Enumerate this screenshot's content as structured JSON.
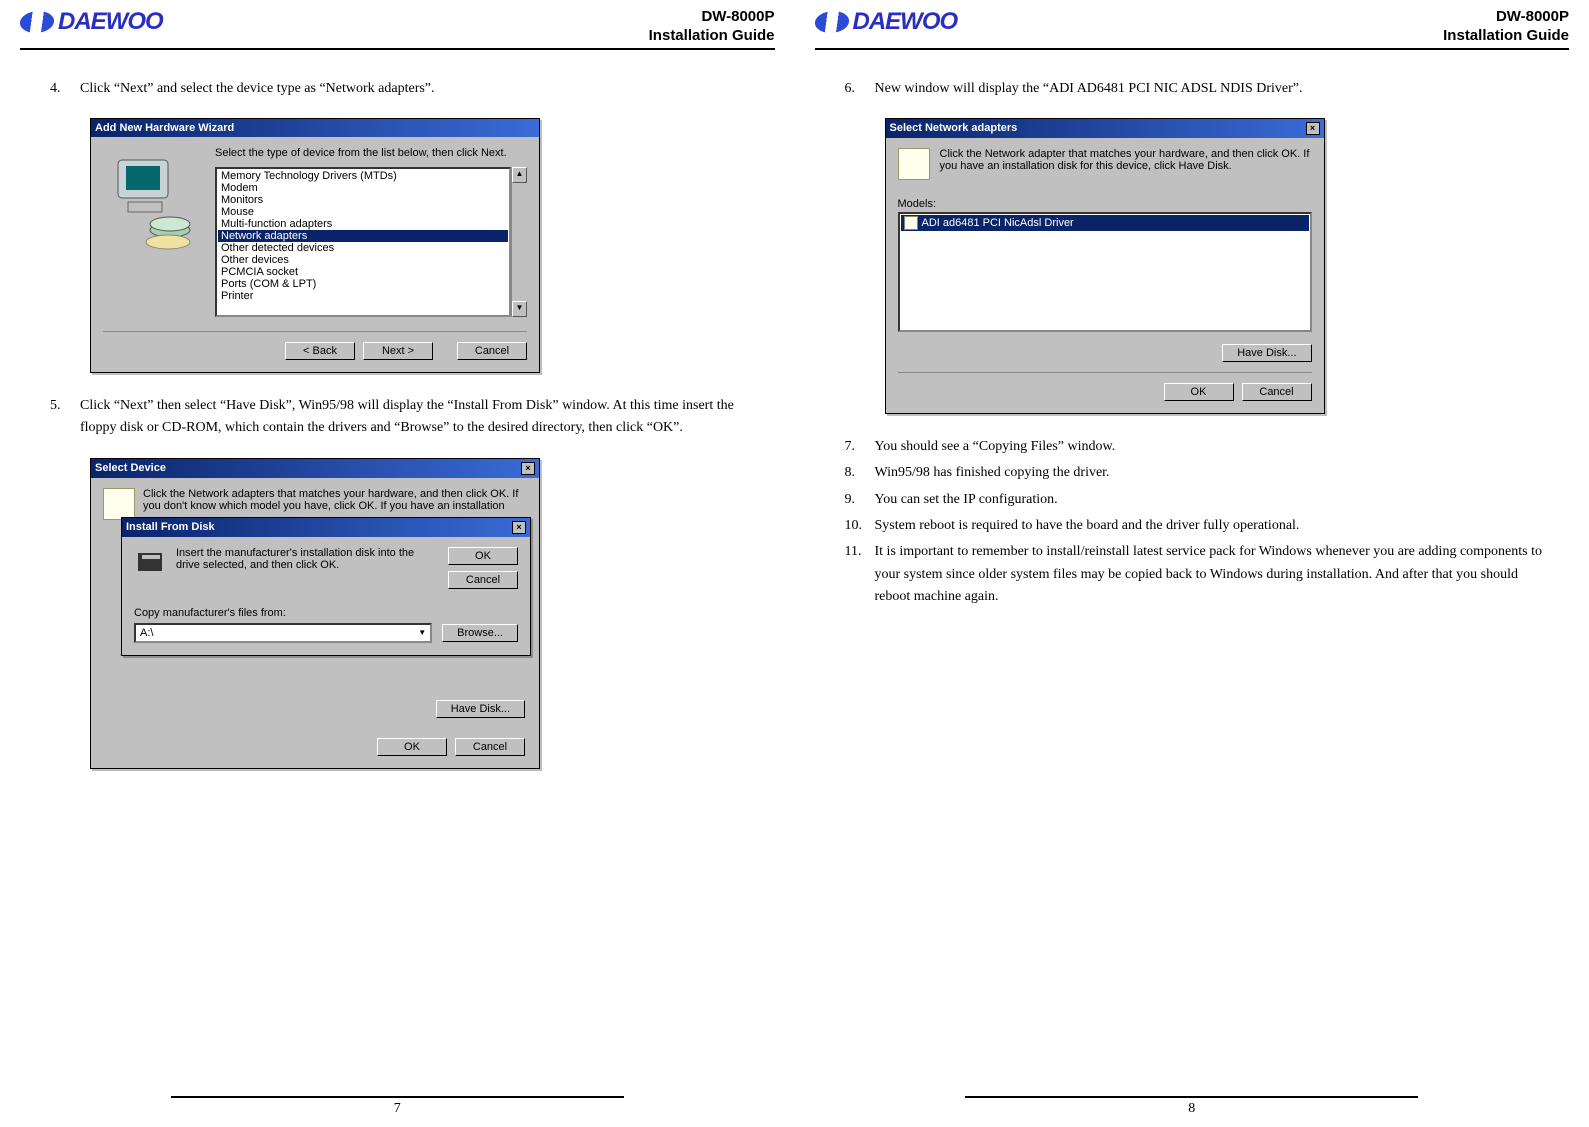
{
  "brand": "DAEWOO",
  "doc_title_line1": "DW-8000P",
  "doc_title_line2": "Installation Guide",
  "left_page": {
    "number": "7",
    "steps": [
      {
        "n": "4.",
        "text": "Click “Next” and select the device type as “Network adapters”."
      },
      {
        "n": "5.",
        "text": "Click “Next” then select “Have Disk”, Win95/98 will display the “Install From Disk” window. At this time insert the floppy disk or CD-ROM, which contain the drivers and “Browse” to the desired directory, then click “OK”."
      }
    ],
    "dlg1": {
      "title": "Add New Hardware Wizard",
      "instruction": "Select the type of device from the list below, then click Next.",
      "items": [
        "Memory Technology Drivers (MTDs)",
        "Modem",
        "Monitors",
        "Mouse",
        "Multi-function adapters",
        "Network adapters",
        "Other detected devices",
        "Other devices",
        "PCMCIA socket",
        "Ports (COM & LPT)",
        "Printer"
      ],
      "selected_index": 5,
      "buttons": {
        "back": "< Back",
        "next": "Next >",
        "cancel": "Cancel"
      }
    },
    "dlg2": {
      "title_outer": "Select Device",
      "outer_text": "Click the Network adapters that matches your hardware, and then click OK. If you don't know which model you have, click OK. If you have an installation",
      "title_inner": "Install From Disk",
      "inner_text": "Insert the manufacturer's installation disk into the drive selected, and then click OK.",
      "copy_label": "Copy manufacturer's files from:",
      "drive": "A:\\",
      "buttons": {
        "ok": "OK",
        "cancel": "Cancel",
        "browse": "Browse...",
        "havedisk": "Have Disk..."
      }
    }
  },
  "right_page": {
    "number": "8",
    "steps": [
      {
        "n": "6.",
        "text": "New window will display the “ADI AD6481 PCI NIC ADSL NDIS Driver”."
      },
      {
        "n": "7.",
        "text": "You should see a “Copying Files” window."
      },
      {
        "n": "8.",
        "text": "Win95/98 has finished copying the driver."
      },
      {
        "n": "9.",
        "text": "You can set the IP configuration."
      },
      {
        "n": "10.",
        "text": "System reboot is required to have the board and the driver fully operational."
      },
      {
        "n": "11.",
        "text": "It is important to remember to install/reinstall latest service pack for Windows whenever you are adding components to your system since older system files may be copied back to Windows during installation. And after that you should reboot machine again."
      }
    ],
    "dlg3": {
      "title": "Select Network adapters",
      "instruction": "Click the Network adapter that matches your hardware, and then click OK. If you have an installation disk for this device, click Have Disk.",
      "models_label": "Models:",
      "model": "ADI ad6481 PCI NicAdsl Driver",
      "buttons": {
        "havedisk": "Have Disk...",
        "ok": "OK",
        "cancel": "Cancel"
      }
    }
  }
}
